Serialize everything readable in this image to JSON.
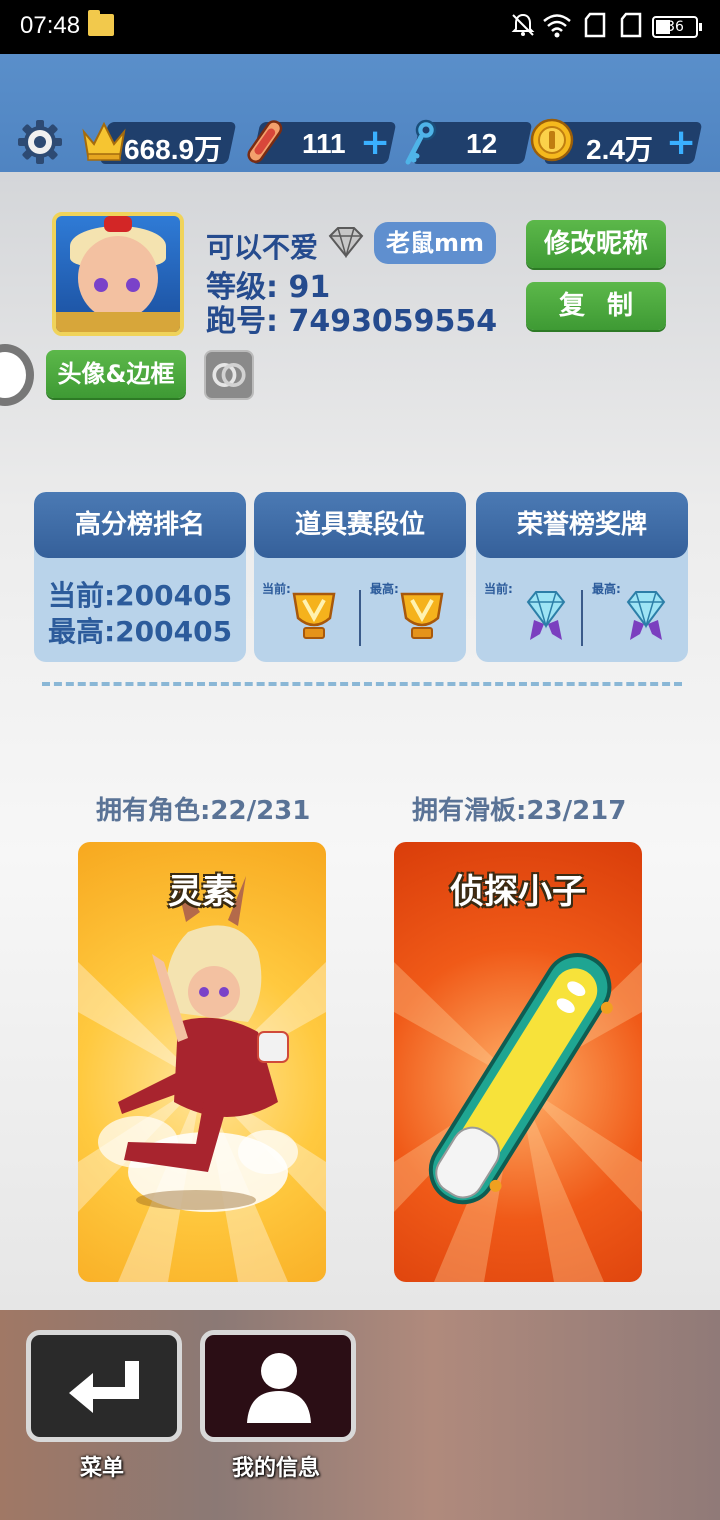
{
  "status_bar": {
    "time": "07:48",
    "battery": "36"
  },
  "resources": {
    "crowns": "668.9万",
    "skateboards": "111",
    "keys": "12",
    "coins": "2.4万"
  },
  "profile": {
    "nickname": "可以不爱",
    "tag": "老鼠mm",
    "level": "等级: 91",
    "run_id": "跑号: 7493059554",
    "rename_button": "修改昵称",
    "copy_button": "复制",
    "avatar_frame_button": "头像&边框"
  },
  "stats": [
    {
      "title": "高分榜排名",
      "current": "当前:200405",
      "best": "最高:200405"
    },
    {
      "title": "道具赛段位",
      "current_label": "当前:",
      "best_label": "最高:"
    },
    {
      "title": "荣誉榜奖牌",
      "current_label": "当前:",
      "best_label": "最高:"
    }
  ],
  "owned": {
    "characters": "拥有角色:22/231",
    "skateboards": "拥有滑板:23/217",
    "character_name": "灵素",
    "skateboard_name": "侦探小子"
  },
  "bottom_nav": {
    "menu": "菜单",
    "my_info": "我的信息"
  },
  "colors": {
    "accent_blue": "#254b8e",
    "green_button": "#4caa3e",
    "topbar": "#5a8fca"
  },
  "icons": [
    "gear-icon",
    "crown-icon",
    "skateboard-icon",
    "key-icon",
    "coin-icon",
    "plus-icon",
    "diamond-icon",
    "rings-icon",
    "trophy-icon",
    "medal-icon",
    "return-icon",
    "person-icon"
  ]
}
